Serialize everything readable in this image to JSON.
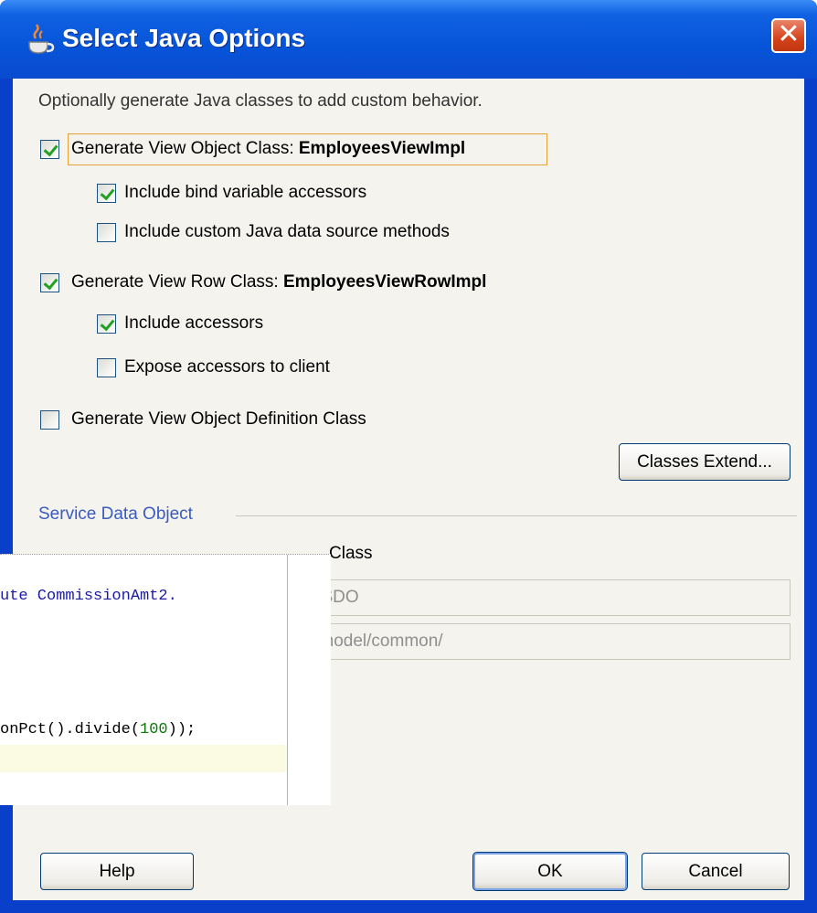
{
  "window": {
    "title": "Select Java Options",
    "close_symbol": "✕"
  },
  "description": "Optionally generate Java classes to add custom behavior.",
  "options": {
    "view_object_class": {
      "label": "Generate View Object Class: ",
      "class_name": "EmployeesViewImpl",
      "checked": true
    },
    "bind_variable_accessors": {
      "label": "Include bind variable accessors",
      "checked": true
    },
    "custom_data_source": {
      "label": "Include custom Java data source methods",
      "checked": false
    },
    "view_row_class": {
      "label": "Generate View Row Class: ",
      "class_name": "EmployeesViewRowImpl",
      "checked": true
    },
    "include_accessors": {
      "label": "Include accessors",
      "checked": true
    },
    "expose_accessors": {
      "label": "Expose accessors to client",
      "checked": false
    },
    "definition_class": {
      "label": "Generate View Object Definition Class",
      "checked": false
    }
  },
  "buttons": {
    "classes_extend": "Classes Extend...",
    "help": "Help",
    "ok": "OK",
    "cancel": "Cancel"
  },
  "sdo": {
    "group_title": "Service Data Object",
    "option_label_partial": "Class",
    "field1_partial": "iewSDO",
    "field2_partial": "air/model/common/"
  },
  "code_overlay": {
    "line1": "ute CommissionAmt2.",
    "line2_prefix": "onPct().divide(",
    "line2_number": "100",
    "line2_suffix": "));"
  },
  "colors": {
    "titlebar": "#0654d8",
    "dialog_bg": "#f4f3ee",
    "check_green": "#21a121",
    "focus_orange": "#e8a238",
    "code_blue": "#1a1aa6",
    "code_green": "#0a7a0a"
  }
}
